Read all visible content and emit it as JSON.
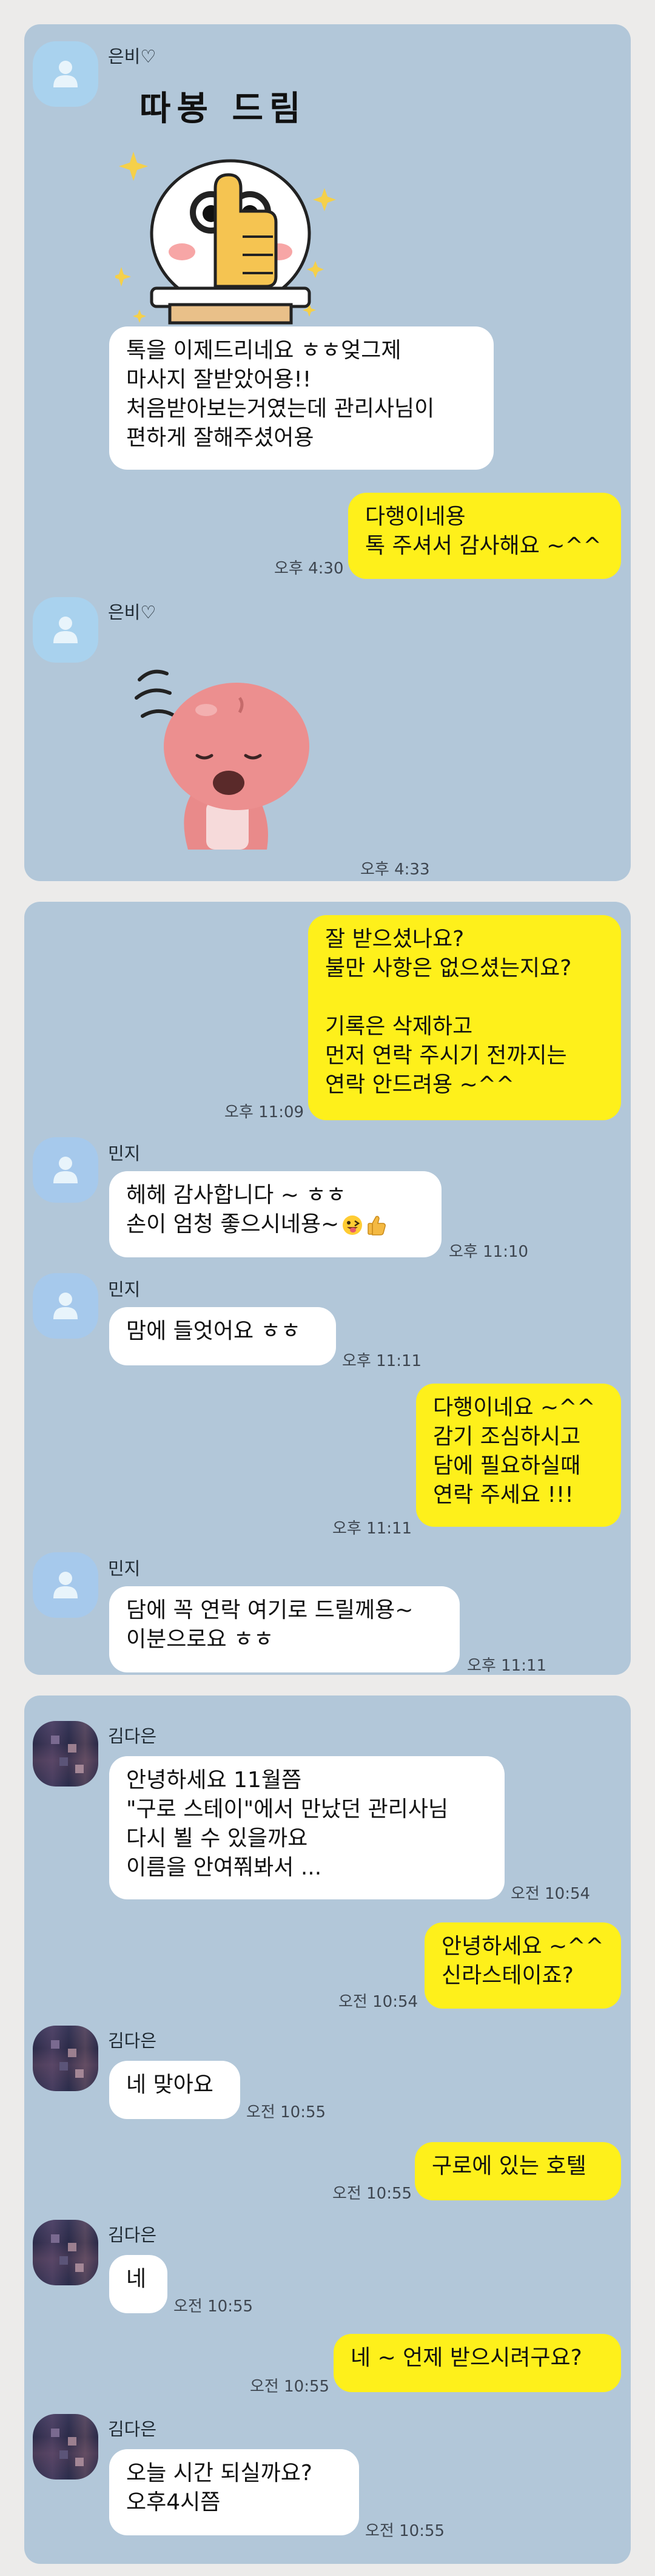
{
  "panel1": {
    "sender1": "은비♡",
    "sticker1_caption": "따봉 드림",
    "msg1": "톡을 이제드리네요 ㅎㅎ엊그제\n마사지 잘받았어용!!\n처음받아보는거였는데 관리사님이\n편하게 잘해주셨어용",
    "reply1": "다행이네용\n톡 주셔서 감사해요 ~^^",
    "reply1_time": "오후 4:30",
    "sender2": "은비♡",
    "sticker2_time": "오후 4:33"
  },
  "panel2": {
    "out1": "잘 받으셨나요?\n불만 사항은 없으셨는지요?\n\n기록은 삭제하고\n먼저 연락 주시기 전까지는\n연락 안드려용 ~^^",
    "out1_time": "오후 11:09",
    "sender1": "민지",
    "in1_line1": "헤헤 감사합니다 ~ ㅎㅎ",
    "in1_line2": "손이 엄청 좋으시네용~",
    "in1_time": "오후 11:10",
    "sender2": "민지",
    "in2": "맘에 들엇어요 ㅎㅎ",
    "in2_time": "오후 11:11",
    "out2": "다행이네요 ~^^\n감기 조심하시고\n담에 필요하실때\n연락 주세요 !!!",
    "out2_time": "오후 11:11",
    "sender3": "민지",
    "in3": "담에 꼭 연락 여기로 드릴께용~\n이분으로요 ㅎㅎ",
    "in3_time": "오후 11:11"
  },
  "panel3": {
    "sender1": "김다은",
    "in1": "안녕하세요 11월쯤\n\"구로 스테이\"에서 만났던 관리사님\n다시 뵐 수 있을까요\n이름을 안여쭤봐서 ...",
    "in1_time": "오전 10:54",
    "out1": "안녕하세요 ~^^\n신라스테이죠?",
    "out1_time": "오전 10:54",
    "sender2": "김다은",
    "in2": "네 맞아요",
    "in2_time": "오전 10:55",
    "out2": "구로에 있는 호텔",
    "out2_time": "오전 10:55",
    "sender3": "김다은",
    "in3": "네",
    "in3_time": "오전 10:55",
    "out3": "네 ~ 언제 받으시려구요?",
    "out3_time": "오전 10:55",
    "sender4": "김다은",
    "in4": "오늘  시간 되실까요?\n오후4시쯤",
    "in4_time": "오전 10:55"
  },
  "colors": {
    "background": "#b2c7d9",
    "outgoing_bubble": "#fef01b",
    "incoming_bubble": "#ffffff"
  },
  "icons": [
    "default-profile-icon",
    "thumbs-up-sticker",
    "pink-creature-sticker",
    "grinning-tongue-emoji",
    "thumbs-up-emoji"
  ]
}
